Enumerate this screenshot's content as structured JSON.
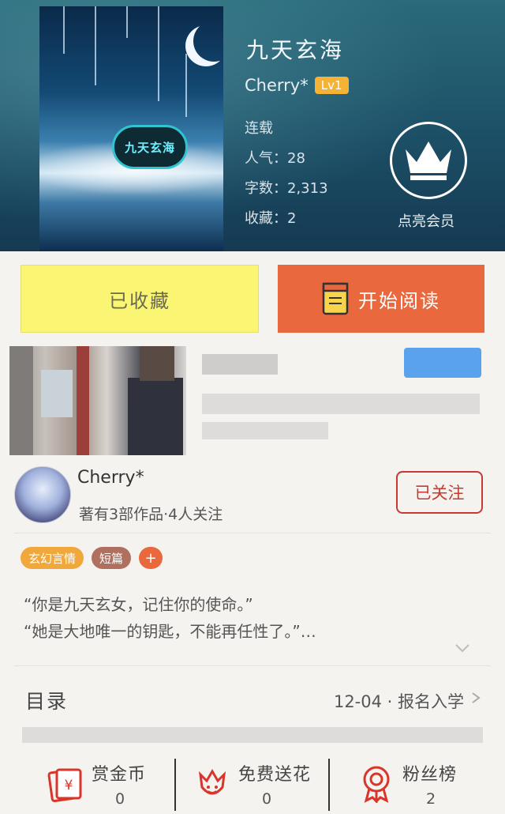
{
  "book": {
    "title": "九天玄海",
    "cover_badge": "九天玄海",
    "author": "Cherry*",
    "level": "Lv1",
    "status": "连载",
    "popularity": "人气：28",
    "word_count": "字数：2,313",
    "favorites": "收藏：2",
    "member_label": "点亮会员"
  },
  "actions": {
    "favorited_label": "已收藏",
    "read_label": "开始阅读"
  },
  "author_section": {
    "name": "Cherry*",
    "description": "著有3部作品·4人关注",
    "follow_label": "已关注"
  },
  "tags": [
    {
      "label": "玄幻言情",
      "color": "#f0a83c"
    },
    {
      "label": "短篇",
      "color": "#b07060"
    }
  ],
  "tag_add": "+",
  "intro": {
    "line1": "“你是九天玄女，记住你的使命。”",
    "line2": "“她是大地唯一的钥匙，不能再任性了。”…"
  },
  "toc": {
    "label": "目录",
    "latest": "12-04 · 报名入学"
  },
  "bottom_bar": {
    "coins_label": "赏金币",
    "coins_count": "0",
    "flowers_label": "免费送花",
    "flowers_count": "0",
    "fans_label": "粉丝榜",
    "fans_count": "2"
  },
  "colors": {
    "accent_orange": "#e9683d",
    "favorite_yellow": "#fbf574",
    "follow_red": "#c53a32",
    "level_badge": "#f5b335",
    "icon_red": "#d9352a"
  }
}
